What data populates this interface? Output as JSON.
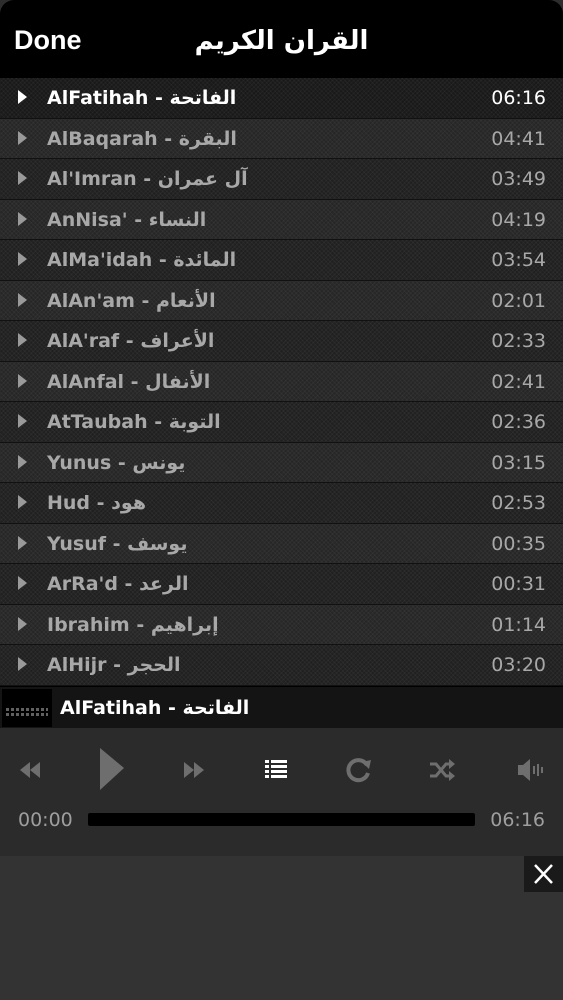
{
  "header": {
    "done_label": "Done",
    "title": "القران الكريم"
  },
  "tracks": [
    {
      "name": "AlFatihah - الفاتحة",
      "duration": "06:16",
      "active": true
    },
    {
      "name": "AlBaqarah - البقرة",
      "duration": "04:41"
    },
    {
      "name": "Al'Imran - آل عمران",
      "duration": "03:49"
    },
    {
      "name": "AnNisa' - النساء",
      "duration": "04:19"
    },
    {
      "name": "AlMa'idah - المائدة",
      "duration": "03:54"
    },
    {
      "name": "AlAn'am - الأنعام",
      "duration": "02:01"
    },
    {
      "name": "AlA'raf - الأعراف",
      "duration": "02:33"
    },
    {
      "name": "AlAnfal - الأنفال",
      "duration": "02:41"
    },
    {
      "name": "AtTaubah - التوبة",
      "duration": "02:36"
    },
    {
      "name": "Yunus - يونس",
      "duration": "03:15"
    },
    {
      "name": "Hud - هود",
      "duration": "02:53"
    },
    {
      "name": "Yusuf - يوسف",
      "duration": "00:35"
    },
    {
      "name": "ArRa'd - الرعد",
      "duration": "00:31"
    },
    {
      "name": "Ibrahim - إبراهيم",
      "duration": "01:14"
    },
    {
      "name": "AlHijr - الحجر",
      "duration": "03:20"
    }
  ],
  "now_playing": {
    "title": "AlFatihah - الفاتحة"
  },
  "player": {
    "current_time": "00:00",
    "total_time": "06:16",
    "progress": 0
  },
  "icons": {
    "rewind": "rewind-icon",
    "play": "play-icon",
    "forward": "fast-forward-icon",
    "playlist": "list-icon",
    "repeat": "repeat-icon",
    "shuffle": "shuffle-icon",
    "volume": "volume-icon",
    "close": "close-icon"
  },
  "colors": {
    "header_bg": "#000000",
    "text_active": "#ffffff",
    "text_inactive": "#a8a8a8",
    "icon_dim": "#6e6e6e"
  }
}
